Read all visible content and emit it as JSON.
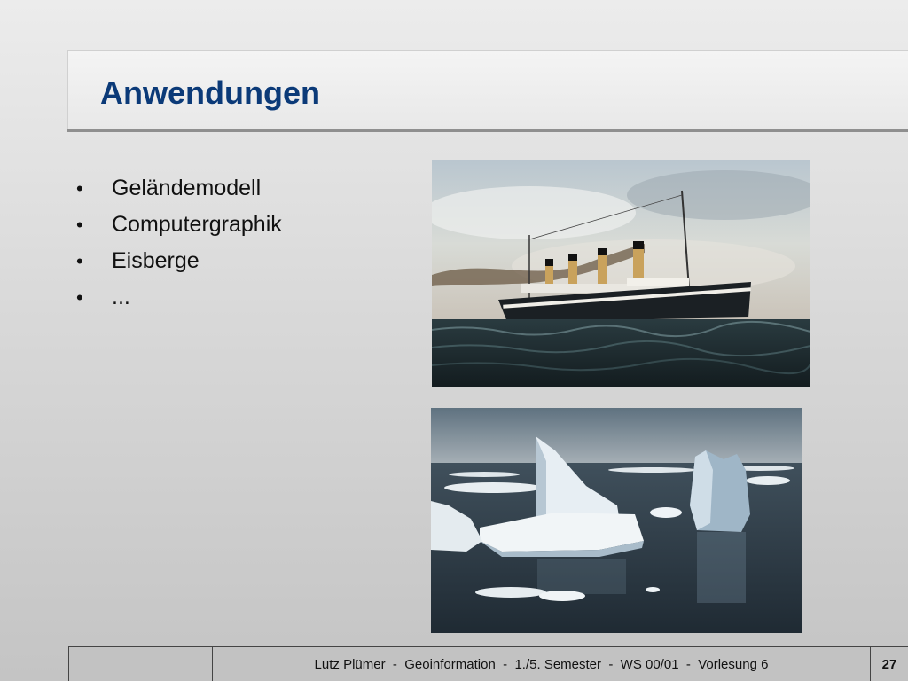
{
  "slide": {
    "title": "Anwendungen",
    "bullets": [
      {
        "marker": "•",
        "text": "Geländemodell"
      },
      {
        "marker": "•",
        "text": "Computergraphik"
      },
      {
        "marker": "•",
        "text": "Eisberge"
      },
      {
        "marker": "•",
        "text": "..."
      }
    ],
    "images": {
      "ship": {
        "subject": "steamship-painting"
      },
      "iceberg": {
        "subject": "icebergs-photo"
      }
    }
  },
  "footer": {
    "left": "",
    "center": "Lutz Plümer  -  Geoinformation  -  1./5. Semester  -  WS 00/01  -  Vorlesung 6",
    "page_number": "27"
  },
  "colors": {
    "title": "#0b3a78",
    "rule": "#8f8f8f"
  }
}
